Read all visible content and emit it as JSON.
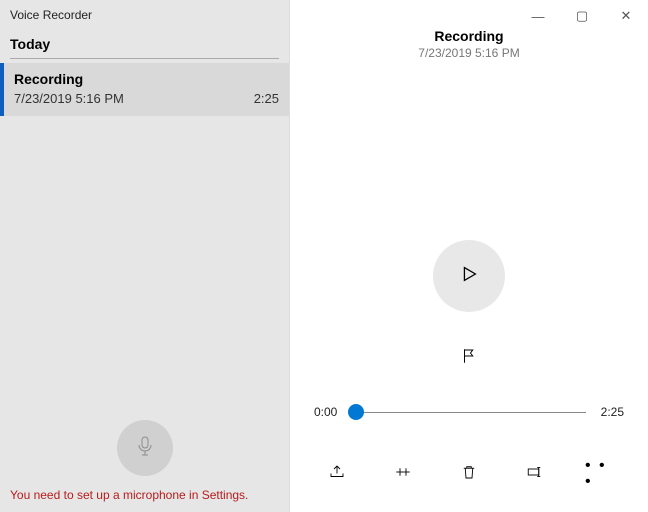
{
  "app_title": "Voice Recorder",
  "sidebar": {
    "section_header": "Today",
    "items": [
      {
        "name": "Recording",
        "timestamp": "7/23/2019 5:16 PM",
        "duration": "2:25",
        "selected": true
      }
    ],
    "warning": "You need to set up a microphone in Settings."
  },
  "main": {
    "title": "Recording",
    "subtitle": "7/23/2019 5:16 PM",
    "playback": {
      "current_time": "0:00",
      "total_time": "2:25",
      "position_pct": 0
    }
  },
  "window_controls": {
    "minimize": "—",
    "maximize": "▢",
    "close": "✕"
  },
  "more_label": "• • •"
}
